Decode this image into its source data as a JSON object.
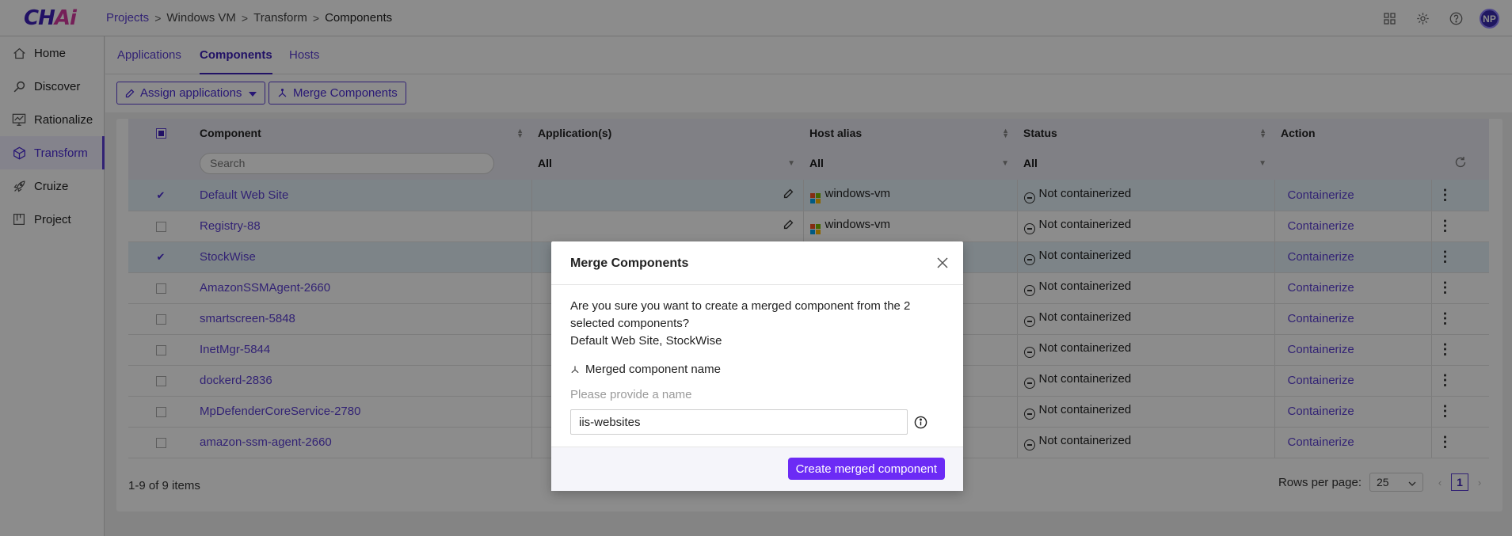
{
  "header": {
    "logo": {
      "main": "CH",
      "accent": "Ai"
    },
    "breadcrumb": [
      "Projects",
      "Windows VM",
      "Transform",
      "Components"
    ],
    "avatar_initials": "NP",
    "icons": [
      "grid-icon",
      "gear-icon",
      "help-icon"
    ]
  },
  "sidebar": {
    "items": [
      {
        "label": "Home",
        "icon": "home-icon"
      },
      {
        "label": "Discover",
        "icon": "search-icon"
      },
      {
        "label": "Rationalize",
        "icon": "chart-icon"
      },
      {
        "label": "Transform",
        "icon": "cube-icon",
        "active": true
      },
      {
        "label": "Cruize",
        "icon": "rocket-icon"
      },
      {
        "label": "Project",
        "icon": "board-icon"
      }
    ]
  },
  "tabs": [
    "Applications",
    "Components",
    "Hosts"
  ],
  "toolbar": {
    "assign_label": "Assign applications",
    "merge_label": "Merge Components"
  },
  "table": {
    "columns": [
      "Component",
      "Application(s)",
      "Host alias",
      "Status",
      "Action"
    ],
    "search_placeholder": "Search",
    "filters": {
      "applications": "All",
      "host": "All",
      "status": "All"
    },
    "rows": [
      {
        "component": "Default Web Site",
        "host": "windows-vm",
        "status": "Not containerized",
        "action": "Containerize",
        "selected": true,
        "editable": true
      },
      {
        "component": "Registry-88",
        "host": "windows-vm",
        "status": "Not containerized",
        "action": "Containerize",
        "selected": false,
        "editable": true
      },
      {
        "component": "StockWise",
        "host": "",
        "status": "Not containerized",
        "action": "Containerize",
        "selected": true,
        "editable": false
      },
      {
        "component": "AmazonSSMAgent-2660",
        "host": "",
        "status": "Not containerized",
        "action": "Containerize",
        "selected": false,
        "editable": false
      },
      {
        "component": "smartscreen-5848",
        "host": "",
        "status": "Not containerized",
        "action": "Containerize",
        "selected": false,
        "editable": false
      },
      {
        "component": "InetMgr-5844",
        "host": "",
        "status": "Not containerized",
        "action": "Containerize",
        "selected": false,
        "editable": false
      },
      {
        "component": "dockerd-2836",
        "host": "",
        "status": "Not containerized",
        "action": "Containerize",
        "selected": false,
        "editable": false
      },
      {
        "component": "MpDefenderCoreService-2780",
        "host": "",
        "status": "Not containerized",
        "action": "Containerize",
        "selected": false,
        "editable": false
      },
      {
        "component": "amazon-ssm-agent-2660",
        "host": "",
        "status": "Not containerized",
        "action": "Containerize",
        "selected": false,
        "editable": false
      }
    ]
  },
  "pagination": {
    "summary": "1-9 of 9 items",
    "rows_per_page_label": "Rows per page:",
    "rows_per_page": "25",
    "current_page": "1"
  },
  "modal": {
    "title": "Merge Components",
    "message": "Are you sure you want to create a merged component from the 2 selected components?",
    "selected": "Default Web Site, StockWise",
    "field_label": "Merged component name",
    "field_help": "Please provide a name",
    "field_value": "iis-websites",
    "submit_label": "Create merged component"
  },
  "colors": {
    "accent": "#5b3fd3",
    "primary_button": "#6c2bf5",
    "selected_row": "#e4f1f7"
  }
}
